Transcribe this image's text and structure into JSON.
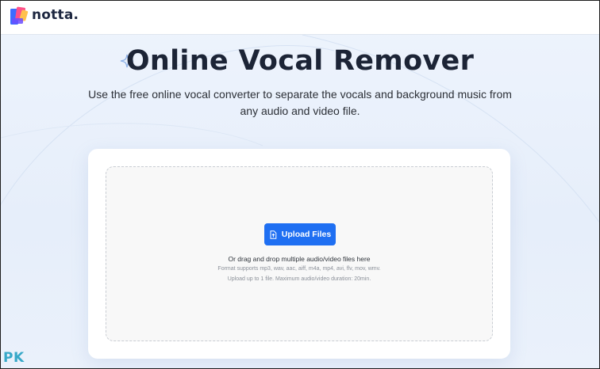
{
  "brand": {
    "name": "notta.",
    "colors": [
      "#3d6bff",
      "#ff4f8a",
      "#ffc14d"
    ]
  },
  "hero": {
    "title": "Online Vocal Remover",
    "subtitle": "Use the free online vocal converter to separate the vocals and background music from any audio and video file."
  },
  "uploader": {
    "button_label": "Upload Files",
    "drag_text": "Or drag and drop multiple audio/video files here",
    "formats_text": "Format supports mp3, wav, aac, aiff, m4a, mp4, avi, flv, mov, wmv.",
    "limit_text": "Upload up to 1 file. Maximum audio/video duration: 20min."
  },
  "watermark": {
    "text": "PK",
    "sub": ""
  },
  "colors": {
    "accent": "#1f6ff2",
    "title": "#1c2436",
    "background": "#e9f1fb"
  }
}
